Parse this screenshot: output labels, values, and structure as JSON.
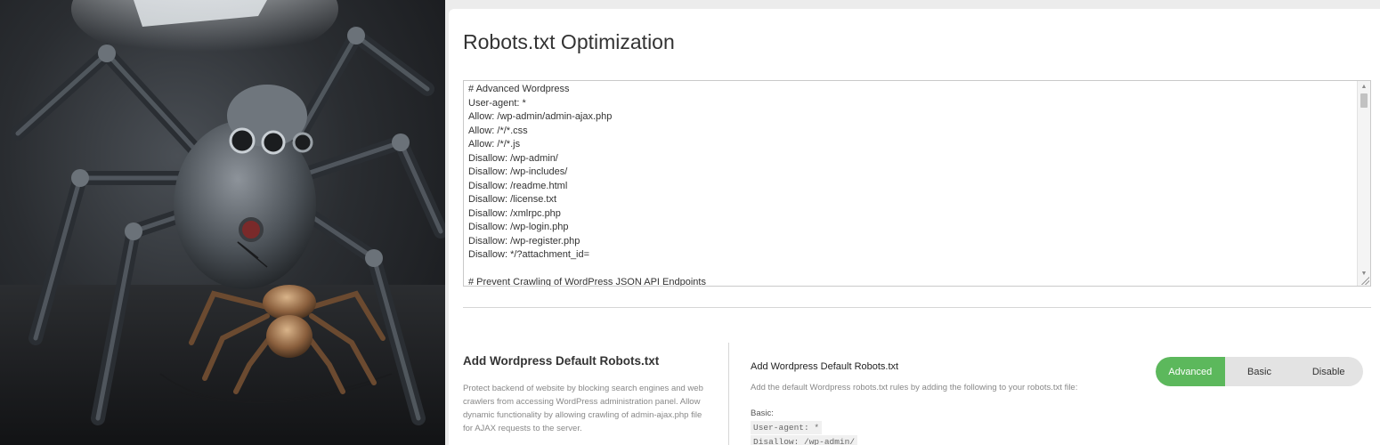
{
  "page": {
    "title": "Robots.txt Optimization"
  },
  "robots_editor": {
    "lines": [
      "# Advanced Wordpress",
      "User-agent: *",
      "Allow: /wp-admin/admin-ajax.php",
      "Allow: /*/*.css",
      "Allow: /*/*.js",
      "Disallow: /wp-admin/",
      "Disallow: /wp-includes/",
      "Disallow: /readme.html",
      "Disallow: /license.txt",
      "Disallow: /xmlrpc.php",
      "Disallow: /wp-login.php",
      "Disallow: /wp-register.php",
      "Disallow: */?attachment_id=",
      "",
      "# Prevent Crawling of WordPress JSON API Endpoints"
    ]
  },
  "section": {
    "heading": "Add Wordpress Default Robots.txt",
    "description": "Protect backend of website by blocking search engines and web crawlers from accessing WordPress administration panel. Allow dynamic functionality by allowing crawling of admin-ajax.php file for AJAX requests to the server.",
    "option_title": "Add Wordpress Default Robots.txt",
    "option_desc": "Add the default Wordpress robots.txt rules by adding the following to your robots.txt file:",
    "basic_label": "Basic:",
    "code_lines": [
      "User-agent: *",
      "Disallow: /wp-admin/"
    ]
  },
  "toggle": {
    "options": [
      "Advanced",
      "Basic",
      "Disable"
    ],
    "selected": "Advanced",
    "active_color": "#5cb85c"
  },
  "icons": {
    "scroll_up": "scroll-up-arrow-icon",
    "scroll_down": "scroll-down-arrow-icon",
    "resize": "resize-grip-icon"
  }
}
